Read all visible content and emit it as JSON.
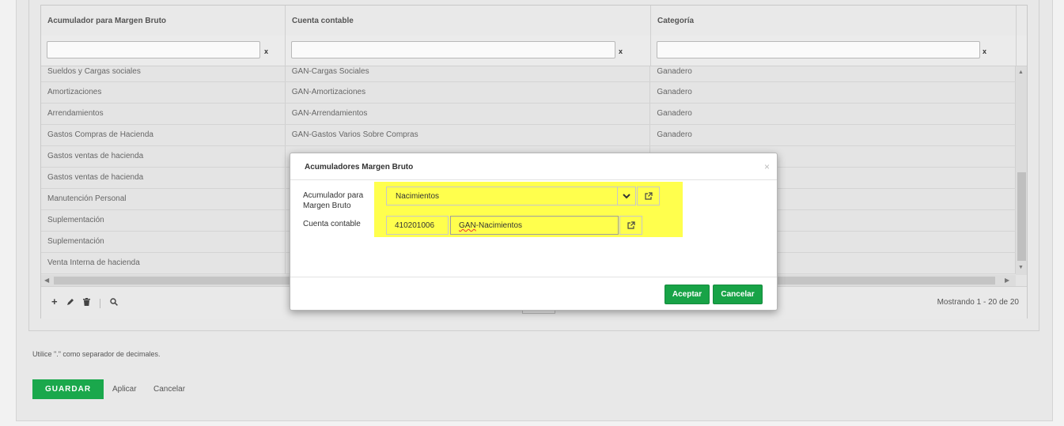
{
  "grid": {
    "columns": [
      "Acumulador para Margen Bruto",
      "Cuenta contable",
      "Categoría"
    ],
    "filter_clear": "x",
    "rows": [
      [
        "Sueldos y Cargas sociales",
        "GAN-Cargas Sociales",
        "Ganadero"
      ],
      [
        "Amortizaciones",
        "GAN-Amortizaciones",
        "Ganadero"
      ],
      [
        "Arrendamientos",
        "GAN-Arrendamientos",
        "Ganadero"
      ],
      [
        "Gastos Compras de Hacienda",
        "GAN-Gastos Varios Sobre Compras",
        "Ganadero"
      ],
      [
        "Gastos ventas de hacienda",
        "",
        ""
      ],
      [
        "Gastos ventas de hacienda",
        "",
        ""
      ],
      [
        "Manutención Personal",
        "",
        ""
      ],
      [
        "Suplementación",
        "",
        ""
      ],
      [
        "Suplementación",
        "",
        ""
      ],
      [
        "Venta Interna de hacienda",
        "",
        ""
      ]
    ],
    "paging_info": "Mostrando 1 - 20 de 20"
  },
  "footer": {
    "note": "Utilice \".\" como separador de decimales.",
    "save_label": "GUARDAR",
    "apply_label": "Aplicar",
    "cancel_label": "Cancelar"
  },
  "dialog": {
    "title": "Acumuladores Margen Bruto",
    "close_glyph": "×",
    "acumulador_label": "Acumulador para Margen Bruto",
    "acumulador_value": "Nacimientos",
    "cuenta_label": "Cuenta contable",
    "cuenta_code": "410201006",
    "cuenta_name_prefix": "GAN",
    "cuenta_name_rest": "-Nacimientos",
    "accept_label": "Aceptar",
    "cancel_label": "Cancelar"
  },
  "colors": {
    "highlight": "#ffff4d",
    "button_green": "#18a347"
  }
}
